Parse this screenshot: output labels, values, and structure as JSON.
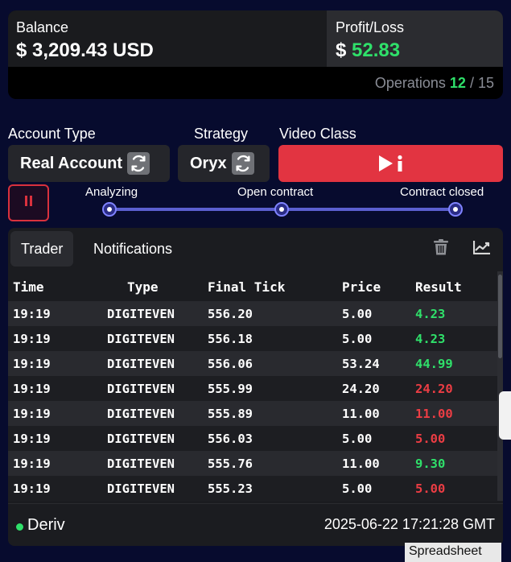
{
  "balance": {
    "label": "Balance",
    "value": "$ 3,209.43 USD"
  },
  "profit_loss": {
    "label": "Profit/Loss",
    "currency": "$",
    "amount": "52.83"
  },
  "operations": {
    "label": "Operations",
    "done": "12",
    "separator": " / ",
    "total": "15"
  },
  "account_type": {
    "label": "Account Type",
    "value": "Real Account",
    "icon": "refresh-icon"
  },
  "strategy": {
    "label": "Strategy",
    "value": "Oryx",
    "icon": "refresh-icon"
  },
  "video_class": {
    "label": "Video Class",
    "icon": "play-info-icon"
  },
  "controls": {
    "pause_icon": "pause-icon"
  },
  "progress": {
    "steps": [
      "Analyzing",
      "Open contract",
      "Contract closed"
    ]
  },
  "tabs": {
    "trader": "Trader",
    "notifications": "Notifications"
  },
  "toolbar": {
    "delete_icon": "trash-icon",
    "chart_icon": "chart-trend-icon"
  },
  "table": {
    "headers": {
      "time": "Time",
      "type": "Type",
      "final_tick": "Final Tick",
      "price": "Price",
      "result": "Result"
    },
    "rows": [
      {
        "time": "19:19",
        "type": "DIGITEVEN",
        "final_tick": "556.20",
        "price": "5.00",
        "result": "4.23",
        "outcome": "win"
      },
      {
        "time": "19:19",
        "type": "DIGITEVEN",
        "final_tick": "556.18",
        "price": "5.00",
        "result": "4.23",
        "outcome": "win"
      },
      {
        "time": "19:19",
        "type": "DIGITEVEN",
        "final_tick": "556.06",
        "price": "53.24",
        "result": "44.99",
        "outcome": "win"
      },
      {
        "time": "19:19",
        "type": "DIGITEVEN",
        "final_tick": "555.99",
        "price": "24.20",
        "result": "24.20",
        "outcome": "loss"
      },
      {
        "time": "19:19",
        "type": "DIGITEVEN",
        "final_tick": "555.89",
        "price": "11.00",
        "result": "11.00",
        "outcome": "loss"
      },
      {
        "time": "19:19",
        "type": "DIGITEVEN",
        "final_tick": "556.03",
        "price": "5.00",
        "result": "5.00",
        "outcome": "loss"
      },
      {
        "time": "19:19",
        "type": "DIGITEVEN",
        "final_tick": "555.76",
        "price": "11.00",
        "result": "9.30",
        "outcome": "win"
      },
      {
        "time": "19:19",
        "type": "DIGITEVEN",
        "final_tick": "555.23",
        "price": "5.00",
        "result": "5.00",
        "outcome": "loss"
      }
    ]
  },
  "footer": {
    "broker": "Deriv",
    "datetime": "2025-06-22 17:21:28 GMT"
  },
  "spreadsheet_tab": "Spreadsheet",
  "colors": {
    "background": "#070b2e",
    "win": "#2fe06a",
    "loss": "#ec3d44",
    "accent_red": "#e23441",
    "progress": "#5b5fcf"
  }
}
